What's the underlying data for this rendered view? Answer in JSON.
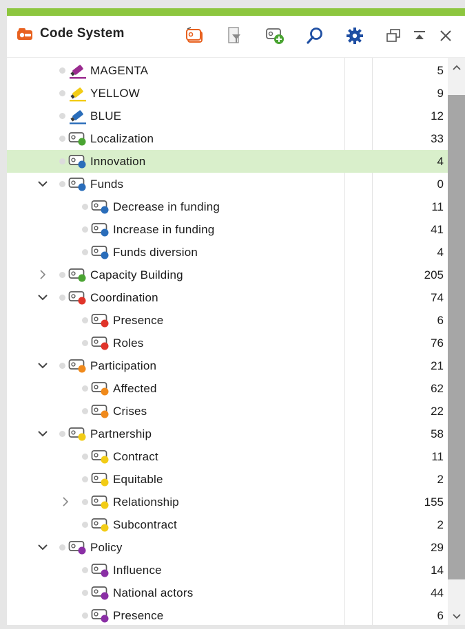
{
  "colors": {
    "accent": "#8dc63f",
    "selection": "#d9efcb",
    "brand": "#e8611f",
    "purple": "#8a2fa5",
    "blue": "#2a6dba",
    "green": "#4aa432",
    "red": "#e0342a",
    "orange": "#f08a1c",
    "yellow": "#f2cc16",
    "magenta": "#9a2b8f"
  },
  "window": {
    "title": "Code System",
    "toolbar_icons": [
      "new-code-set-icon",
      "filter-icon",
      "add-code-icon",
      "search-icon",
      "gear-icon"
    ],
    "window_controls": [
      "undock-icon",
      "collapse-icon",
      "close-icon"
    ]
  },
  "tree": {
    "rows": [
      {
        "label": "MAGENTA",
        "count": "5",
        "icon": "highlighter-icon",
        "color": "magenta",
        "level": 0,
        "chevron": "none"
      },
      {
        "label": "YELLOW",
        "count": "9",
        "icon": "highlighter-icon",
        "color": "yellow",
        "level": 0,
        "chevron": "none"
      },
      {
        "label": "BLUE",
        "count": "12",
        "icon": "highlighter-icon",
        "color": "blue",
        "level": 0,
        "chevron": "none"
      },
      {
        "label": "Localization",
        "count": "33",
        "icon": "code-tag-icon",
        "color": "green",
        "level": 0,
        "chevron": "none"
      },
      {
        "label": "Innovation",
        "count": "4",
        "icon": "code-tag-icon",
        "color": "blue",
        "level": 0,
        "chevron": "none",
        "selected": true
      },
      {
        "label": "Funds",
        "count": "0",
        "icon": "code-tag-icon",
        "color": "blue",
        "level": 0,
        "chevron": "expanded"
      },
      {
        "label": "Decrease in funding",
        "count": "11",
        "icon": "code-tag-icon",
        "color": "blue",
        "level": 1,
        "chevron": "none"
      },
      {
        "label": "Increase in funding",
        "count": "41",
        "icon": "code-tag-icon",
        "color": "blue",
        "level": 1,
        "chevron": "none"
      },
      {
        "label": "Funds diversion",
        "count": "4",
        "icon": "code-tag-icon",
        "color": "blue",
        "level": 1,
        "chevron": "none"
      },
      {
        "label": "Capacity Building",
        "count": "205",
        "icon": "code-tag-icon",
        "color": "green",
        "level": 0,
        "chevron": "collapsed"
      },
      {
        "label": "Coordination",
        "count": "74",
        "icon": "code-tag-icon",
        "color": "red",
        "level": 0,
        "chevron": "expanded"
      },
      {
        "label": "Presence",
        "count": "6",
        "icon": "code-tag-icon",
        "color": "red",
        "level": 1,
        "chevron": "none"
      },
      {
        "label": "Roles",
        "count": "76",
        "icon": "code-tag-icon",
        "color": "red",
        "level": 1,
        "chevron": "none"
      },
      {
        "label": "Participation",
        "count": "21",
        "icon": "code-tag-icon",
        "color": "orange",
        "level": 0,
        "chevron": "expanded"
      },
      {
        "label": "Affected",
        "count": "62",
        "icon": "code-tag-icon",
        "color": "orange",
        "level": 1,
        "chevron": "none"
      },
      {
        "label": "Crises",
        "count": "22",
        "icon": "code-tag-icon",
        "color": "orange",
        "level": 1,
        "chevron": "none"
      },
      {
        "label": "Partnership",
        "count": "58",
        "icon": "code-tag-icon",
        "color": "yellow",
        "level": 0,
        "chevron": "expanded"
      },
      {
        "label": "Contract",
        "count": "11",
        "icon": "code-tag-icon",
        "color": "yellow",
        "level": 1,
        "chevron": "none"
      },
      {
        "label": "Equitable",
        "count": "2",
        "icon": "code-tag-icon",
        "color": "yellow",
        "level": 1,
        "chevron": "none"
      },
      {
        "label": "Relationship",
        "count": "155",
        "icon": "code-tag-icon",
        "color": "yellow",
        "level": 1,
        "chevron": "collapsed"
      },
      {
        "label": "Subcontract",
        "count": "2",
        "icon": "code-tag-icon",
        "color": "yellow",
        "level": 1,
        "chevron": "none"
      },
      {
        "label": "Policy",
        "count": "29",
        "icon": "code-tag-icon",
        "color": "purple",
        "level": 0,
        "chevron": "expanded"
      },
      {
        "label": "Influence",
        "count": "14",
        "icon": "code-tag-icon",
        "color": "purple",
        "level": 1,
        "chevron": "none"
      },
      {
        "label": "National actors",
        "count": "44",
        "icon": "code-tag-icon",
        "color": "purple",
        "level": 1,
        "chevron": "none"
      },
      {
        "label": "Presence",
        "count": "6",
        "icon": "code-tag-icon",
        "color": "purple",
        "level": 1,
        "chevron": "none"
      }
    ]
  }
}
